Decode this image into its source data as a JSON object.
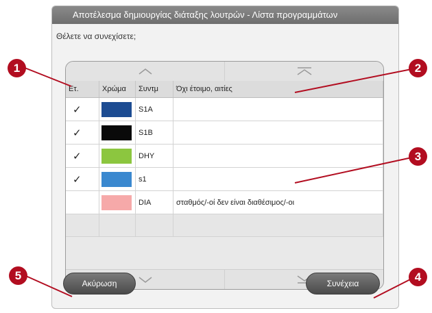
{
  "dialog": {
    "title": "Αποτέλεσμα δημιουργίας διάταξης λουτρών - Λίστα προγραμμάτων",
    "question": "Θέλετε να συνεχίσετε;"
  },
  "table": {
    "headers": [
      "Ετ.",
      "Χρώμα",
      "Συντμ",
      "Όχι έτοιμο, αιτίες"
    ],
    "rows": [
      {
        "ready": "✓",
        "color": "#1d4c92",
        "abbr": "S1A",
        "reason": ""
      },
      {
        "ready": "✓",
        "color": "#0a0a0a",
        "abbr": "S1B",
        "reason": ""
      },
      {
        "ready": "✓",
        "color": "#8cc63f",
        "abbr": "DHY",
        "reason": ""
      },
      {
        "ready": "✓",
        "color": "#3a88cf",
        "abbr": "s1",
        "reason": ""
      },
      {
        "ready": "",
        "color": "#f6a9a9",
        "abbr": "DIA",
        "reason": "σταθμός/-οί δεν είναι διαθέσιμος/-οι"
      }
    ]
  },
  "buttons": {
    "cancel": "Ακύρωση",
    "continue": "Συνέχεια"
  },
  "callouts": [
    "1",
    "2",
    "3",
    "4",
    "5"
  ],
  "colors": {
    "callout": "#b20d20",
    "titlebar": "#7c7c7c"
  }
}
